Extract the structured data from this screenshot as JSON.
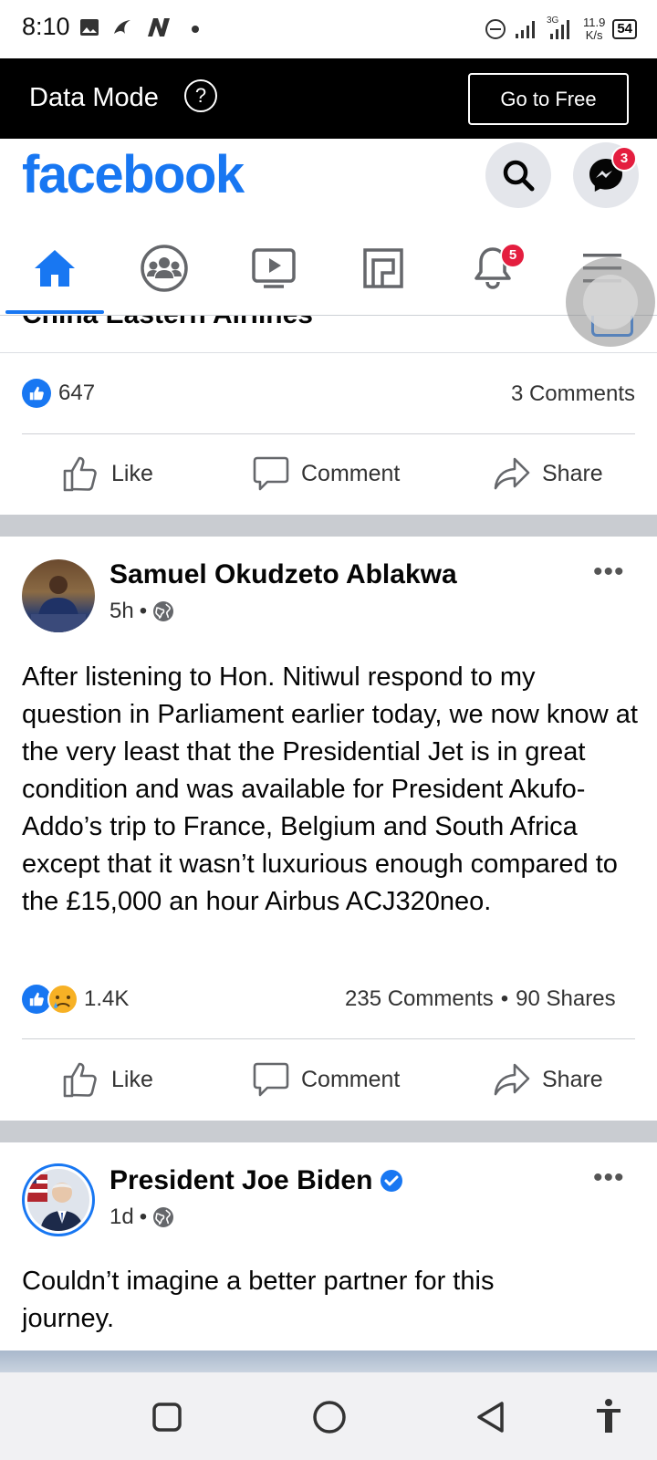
{
  "status_bar": {
    "time": "8:10",
    "netspeed_value": "11.9",
    "netspeed_unit": "K/s",
    "battery": "54",
    "network_type": "3G"
  },
  "data_mode": {
    "label": "Data Mode",
    "help": "?",
    "go_free": "Go to Free"
  },
  "header": {
    "logo": "facebook",
    "messenger_badge": "3"
  },
  "nav": {
    "notifications_badge": "5"
  },
  "previous_post": {
    "headline": "China Eastern Airlines",
    "likes": "647",
    "comments": "3 Comments",
    "actions": {
      "like": "Like",
      "comment": "Comment",
      "share": "Share"
    }
  },
  "post1": {
    "author": "Samuel Okudzeto Ablakwa",
    "time": "5h",
    "separator": "•",
    "more": "•••",
    "text": "After listening to Hon. Nitiwul respond to my question in Parliament earlier today, we now know at the very least that the Presidential Jet is in great condition and was available for President Akufo-Addo’s trip to France, Belgium and South Africa except that it wasn’t luxurious enough compared to the £15,000 an hour Airbus ACJ320neo.",
    "reactions": "1.4K",
    "comments": "235 Comments",
    "shares": "90 Shares",
    "actions": {
      "like": "Like",
      "comment": "Comment",
      "share": "Share"
    }
  },
  "post2": {
    "author": "President Joe Biden",
    "time": "1d",
    "separator": "•",
    "more": "•••",
    "text": "Couldn’t imagine a better partner for this journey."
  },
  "colors": {
    "brand": "#1877f2",
    "badge": "#e41e3f",
    "data_bar": "#000000",
    "feed_gap": "#c9ccd1"
  }
}
